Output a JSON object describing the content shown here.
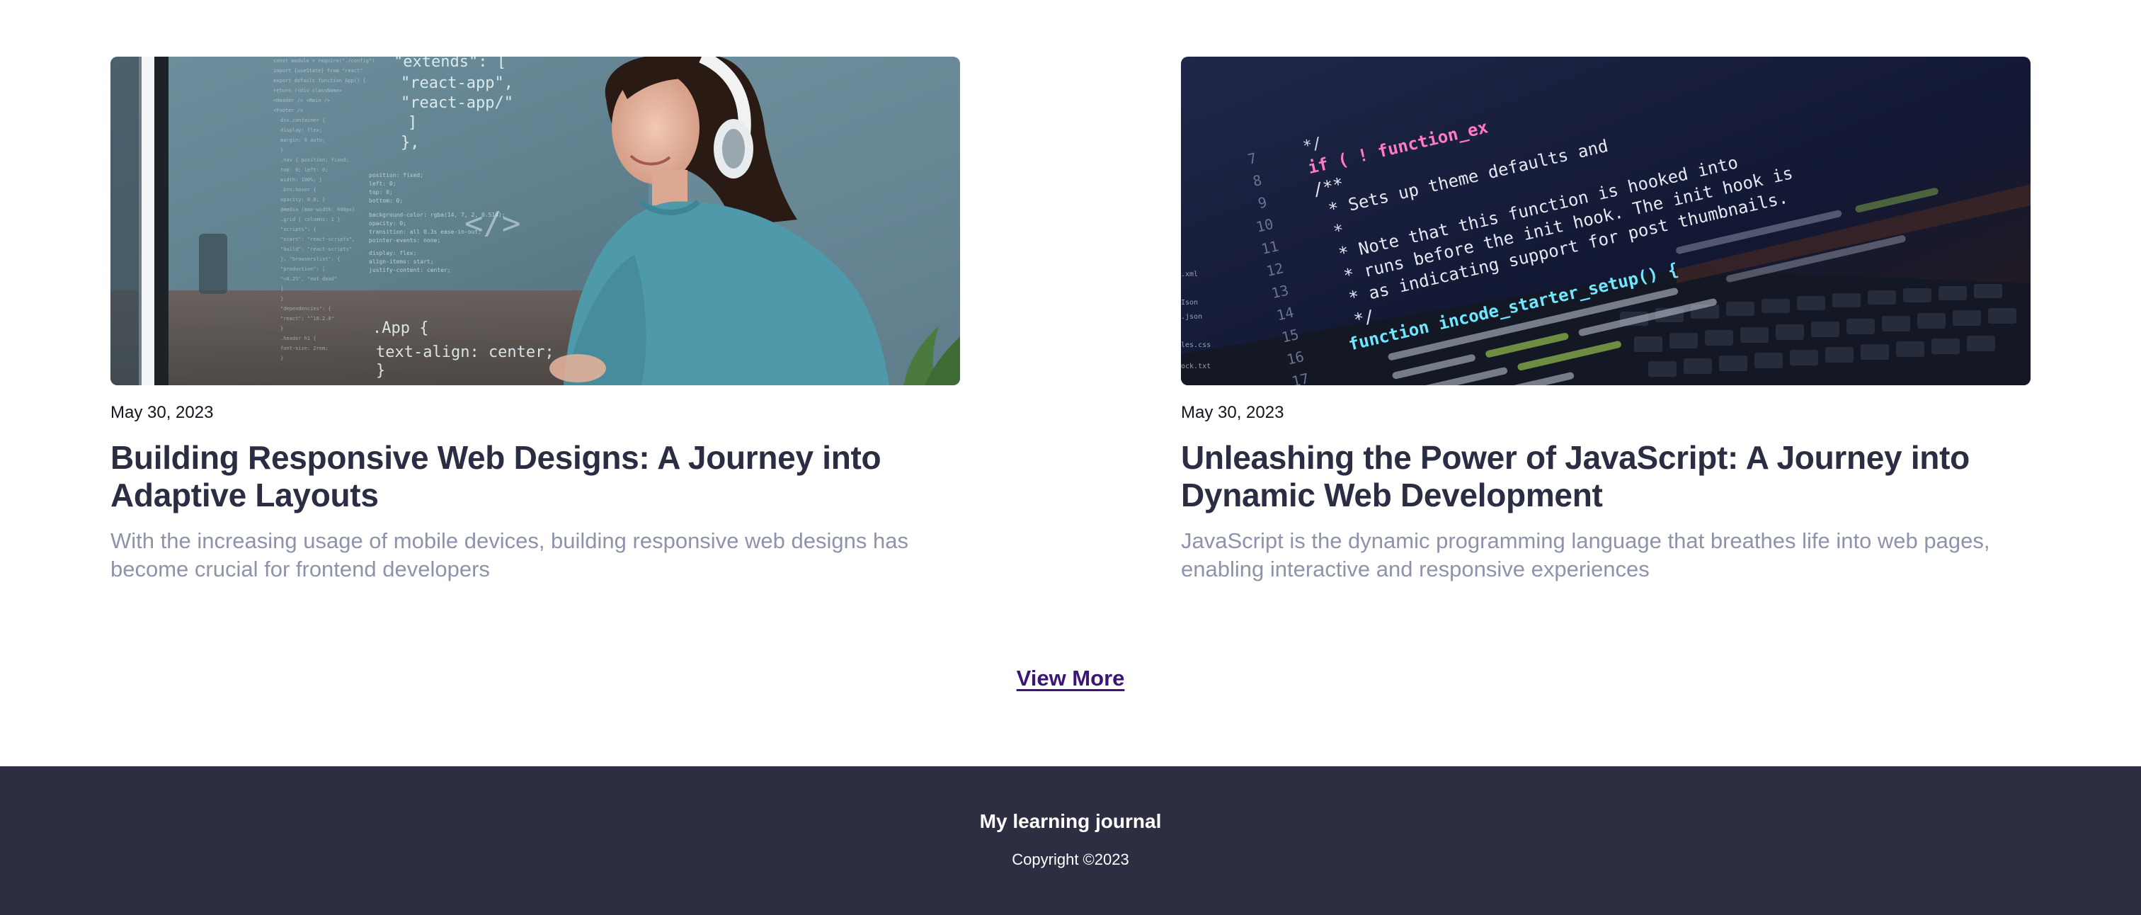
{
  "posts": [
    {
      "image_description": "woman-with-headphones-coding",
      "date": "May 30, 2023",
      "title": "Building Responsive Web Designs: A Journey into Adaptive Layouts",
      "excerpt": "With the increasing usage of mobile devices, building responsive web designs has become crucial for frontend developers",
      "code_text": {
        "l1": "\"extends\": [",
        "l2": "\"react-app\",",
        "l3": "\"react-app/\"",
        "l4": "]",
        "l5": "},",
        "tag": "</>",
        "css1": ".App {",
        "css2": "text-align: center;",
        "css3": "}"
      }
    },
    {
      "image_description": "javascript-code-on-laptop",
      "date": "May 30, 2023",
      "title": "Unleashing the Power of JavaScript: A Journey into Dynamic Web Development",
      "excerpt": "JavaScript is the dynamic programming language that breathes life into web pages, enabling interactive and responsive experiences",
      "code_text": {
        "c1": "if ( ! function_ex",
        "c2": "/**",
        "c3": "* Sets up theme defaults and",
        "c4": "* Note that this function is hooked into",
        "c5": "* runs before the init hook. The init hook is",
        "c6": "* as indicating support for post thumbnails.",
        "c7": "*/",
        "c8": "function incode_starter_setup() {"
      }
    }
  ],
  "view_more_label": "View More",
  "footer": {
    "title": "My learning journal",
    "copyright": "Copyright ©2023"
  },
  "colors": {
    "footer_bg": "#2d2e42",
    "title": "#2b2d42",
    "excerpt": "#8d93ab",
    "link": "#3d1575"
  }
}
